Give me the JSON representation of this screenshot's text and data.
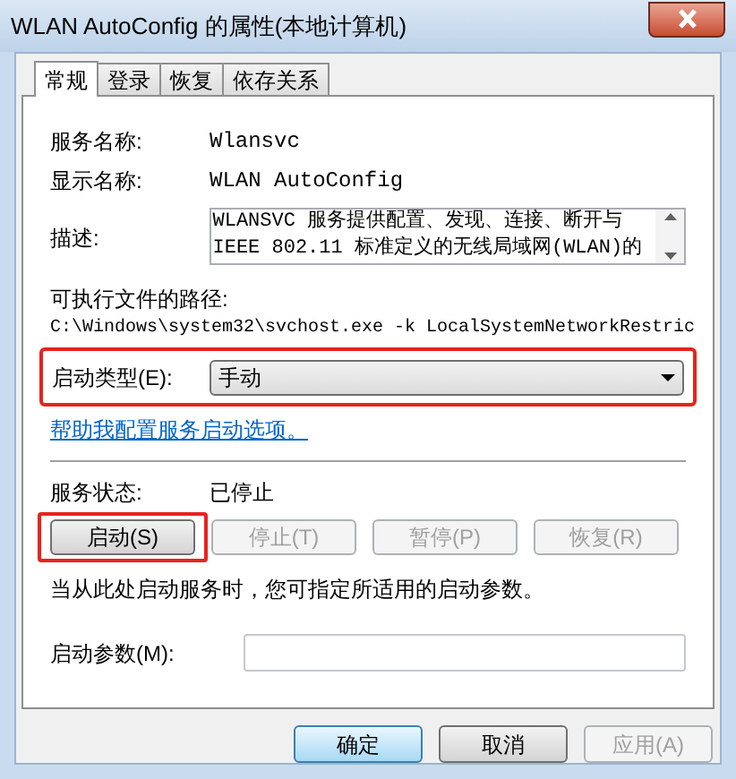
{
  "window": {
    "title": "WLAN AutoConfig 的属性(本地计算机)"
  },
  "tabs": [
    {
      "label": "常规",
      "selected": true
    },
    {
      "label": "登录",
      "selected": false
    },
    {
      "label": "恢复",
      "selected": false
    },
    {
      "label": "依存关系",
      "selected": false
    }
  ],
  "service_name": {
    "label": "服务名称:",
    "value": "Wlansvc"
  },
  "display_name": {
    "label": "显示名称:",
    "value": "WLAN AutoConfig"
  },
  "description": {
    "label": "描述:",
    "lines": [
      "WLANSVC 服务提供配置、发现、连接、断开与",
      "IEEE 802.11 标准定义的无线局域网(WLAN)的"
    ]
  },
  "executable_path": {
    "label": "可执行文件的路径:",
    "value": "C:\\Windows\\system32\\svchost.exe -k LocalSystemNetworkRestric"
  },
  "startup_type": {
    "label": "启动类型(E):",
    "value": "手动",
    "highlighted": true
  },
  "help_link": "帮助我配置服务启动选项。",
  "service_status": {
    "label": "服务状态:",
    "value": "已停止"
  },
  "service_buttons": [
    {
      "label": "启动(S)",
      "disabled": false,
      "highlighted": true
    },
    {
      "label": "停止(T)",
      "disabled": true,
      "highlighted": false
    },
    {
      "label": "暂停(P)",
      "disabled": true,
      "highlighted": false
    },
    {
      "label": "恢复(R)",
      "disabled": true,
      "highlighted": false
    }
  ],
  "start_parameters_note": "当从此处启动服务时，您可指定所适用的启动参数。",
  "start_parameters": {
    "label": "启动参数(M):"
  },
  "dialog_buttons": [
    {
      "label": "确定",
      "disabled": false,
      "default": true
    },
    {
      "label": "取消",
      "disabled": false,
      "default": false
    },
    {
      "label": "应用(A)",
      "disabled": true,
      "default": false
    }
  ]
}
